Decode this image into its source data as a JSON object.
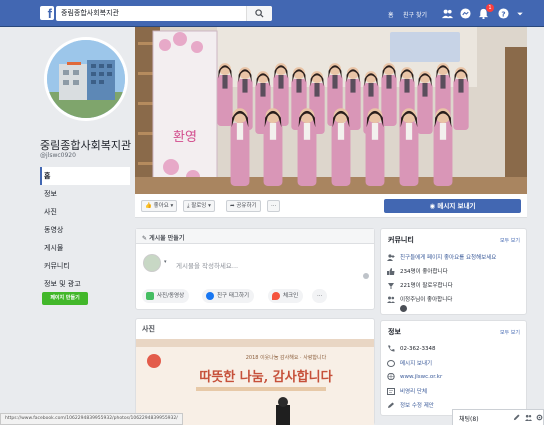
{
  "topbar": {
    "logo": "f",
    "search_value": "중림종합사회복지관",
    "home_label": "홈",
    "find_friends_label": "친구 찾기",
    "notification_count": "1",
    "icons": [
      "friends-icon",
      "messenger-icon",
      "notifications-icon",
      "help-icon",
      "dropdown-icon"
    ]
  },
  "profile": {
    "name": "중림종합사회복지관",
    "handle": "@jlswc0920"
  },
  "nav": {
    "items": [
      {
        "label": "홈"
      },
      {
        "label": "정보"
      },
      {
        "label": "사진"
      },
      {
        "label": "동영상"
      },
      {
        "label": "게시물"
      },
      {
        "label": "커뮤니티"
      },
      {
        "label": "정보 및 광고"
      }
    ],
    "create_page_label": "페이지 만들기"
  },
  "cover": {
    "banner_text": "환영"
  },
  "actions": {
    "like": "좋아요",
    "follow": "팔로잉",
    "share": "공유하기",
    "more": "···",
    "message": "메시지 보내기"
  },
  "composer": {
    "header": "게시물 만들기",
    "placeholder": "게시물을 작성하세요...",
    "chips": [
      "사진/동영상",
      "친구 태그하기",
      "체크인"
    ],
    "more": "···"
  },
  "photos": {
    "title": "사진",
    "banner_main": "따뜻한 나눔, 감사합니다",
    "banner_top": "2018 이웃나눔 감사해요 · 사랑합니다"
  },
  "community": {
    "title": "커뮤니티",
    "see_all": "모두 보기",
    "rows": [
      "친구들에게 페이지 좋아요를 요청해보세요",
      "234명이 좋아합니다",
      "221명이 팔로우합니다",
      "이정주님이 좋아합니다"
    ]
  },
  "info": {
    "title": "정보",
    "see_all": "모두 보기",
    "rows": [
      "02-362-3348",
      "메시지 보내기",
      "www.jlswc.or.kr",
      "비영리 단체",
      "정보 수정 제안"
    ]
  },
  "chat": {
    "label": "채팅(8)"
  },
  "status_url": "https://www.facebook.com/1062294839955932/photos/1062294839955932/",
  "colors": {
    "brand": "#4267b2",
    "page_bg": "#e9ebee",
    "create_button": "#42b72a",
    "badge": "#fa3e3e"
  }
}
